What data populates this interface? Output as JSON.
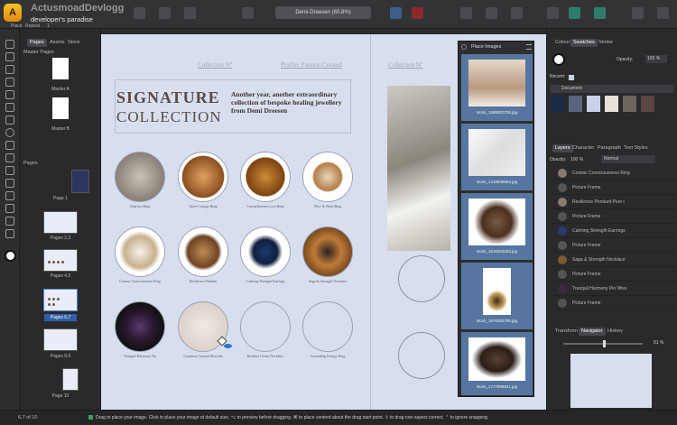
{
  "app": {
    "watermark_top": "ActusmoadDevlogg",
    "watermark_bottom": "developer's paradise",
    "menu": [
      "Place",
      "Repeat"
    ],
    "repeat_value": "1",
    "document_title": "Demi-Dreesen (60.8%)"
  },
  "left_panel": {
    "tabs": [
      "Pages",
      "Assets",
      "Stock"
    ],
    "master_section": "Master Pages",
    "masters": [
      "Master A",
      "Master B"
    ],
    "pages_section": "Pages",
    "pages": [
      "Page 1",
      "Pages 2,3",
      "Pages 4,5",
      "Pages 6,7",
      "Pages 8,9",
      "Page 10"
    ],
    "selected_page": "Pages 6,7"
  },
  "canvas": {
    "left_header": "Collection Nº",
    "middle_header": "Profile: Passion Created",
    "right_header": "Collection Nº",
    "title_line1": "SIGNATURE",
    "title_line2": "COLLECTION",
    "blurb": "Another year, another extraordinary collection of bespoke healing jewellery from Demi Dreesen",
    "items": [
      "Charitos Ring",
      "Quiet Cottage Ring",
      "Constellations Love Ring",
      "Wise & Wind Ring",
      "Cosmic Consciousness Ring",
      "Resilience Pendant",
      "Calming Strength Earrings",
      "Saga & Strength Necklace",
      "Tranquil Harmony Pin",
      "Luminary Ground Bracelet",
      "Restless Ocean Necklace",
      "Grounding Energy Ring"
    ]
  },
  "place_images": {
    "title": "Place Images",
    "files": [
      "stock_1388820726.jpg",
      "stock_1419635953.jpg",
      "stock_1616263253.jpg",
      "stock_1676283780.jpg",
      "stock_1777699821.jpg"
    ]
  },
  "right_panel": {
    "tabs_top": [
      "Colour",
      "Swatches",
      "Stroke"
    ],
    "opacity_label": "Opacity:",
    "opacity_value": "100 %",
    "recent_label": "Recent:",
    "palette_name": "Document",
    "swatch_colors": [
      "#1d2a44",
      "#5a667e",
      "#c8d3ea",
      "#e8e2d6",
      "#6b655a",
      "#5b4741"
    ],
    "tabs_layers": [
      "Layers",
      "Character",
      "Paragraph",
      "Text Styles"
    ],
    "layer_opacity": "100 %",
    "blend_mode": "Normal",
    "layers": [
      "Cosmic Consciousness Ring",
      "Picture Frame",
      "Resilience Pendant Pure t",
      "Picture Frame",
      "Calming Strength Earrings",
      "Picture Frame",
      "Saga & Strength Necklace",
      "Picture Frame",
      "Tranquil Harmony Pin Wiss",
      "Picture Frame"
    ],
    "tabs_bottom": [
      "Transform",
      "Navigator",
      "History"
    ],
    "zoom_value": "91 %"
  },
  "status": {
    "page_counter": "6,7 of 10",
    "hint": "Drag to place your image. Click to place your image at default size. ⌥ to preview before dragging. ⌘ to place centred about the drag start point. ⇧ to drag non-aspect correct. ⌃ to ignore snapping."
  }
}
